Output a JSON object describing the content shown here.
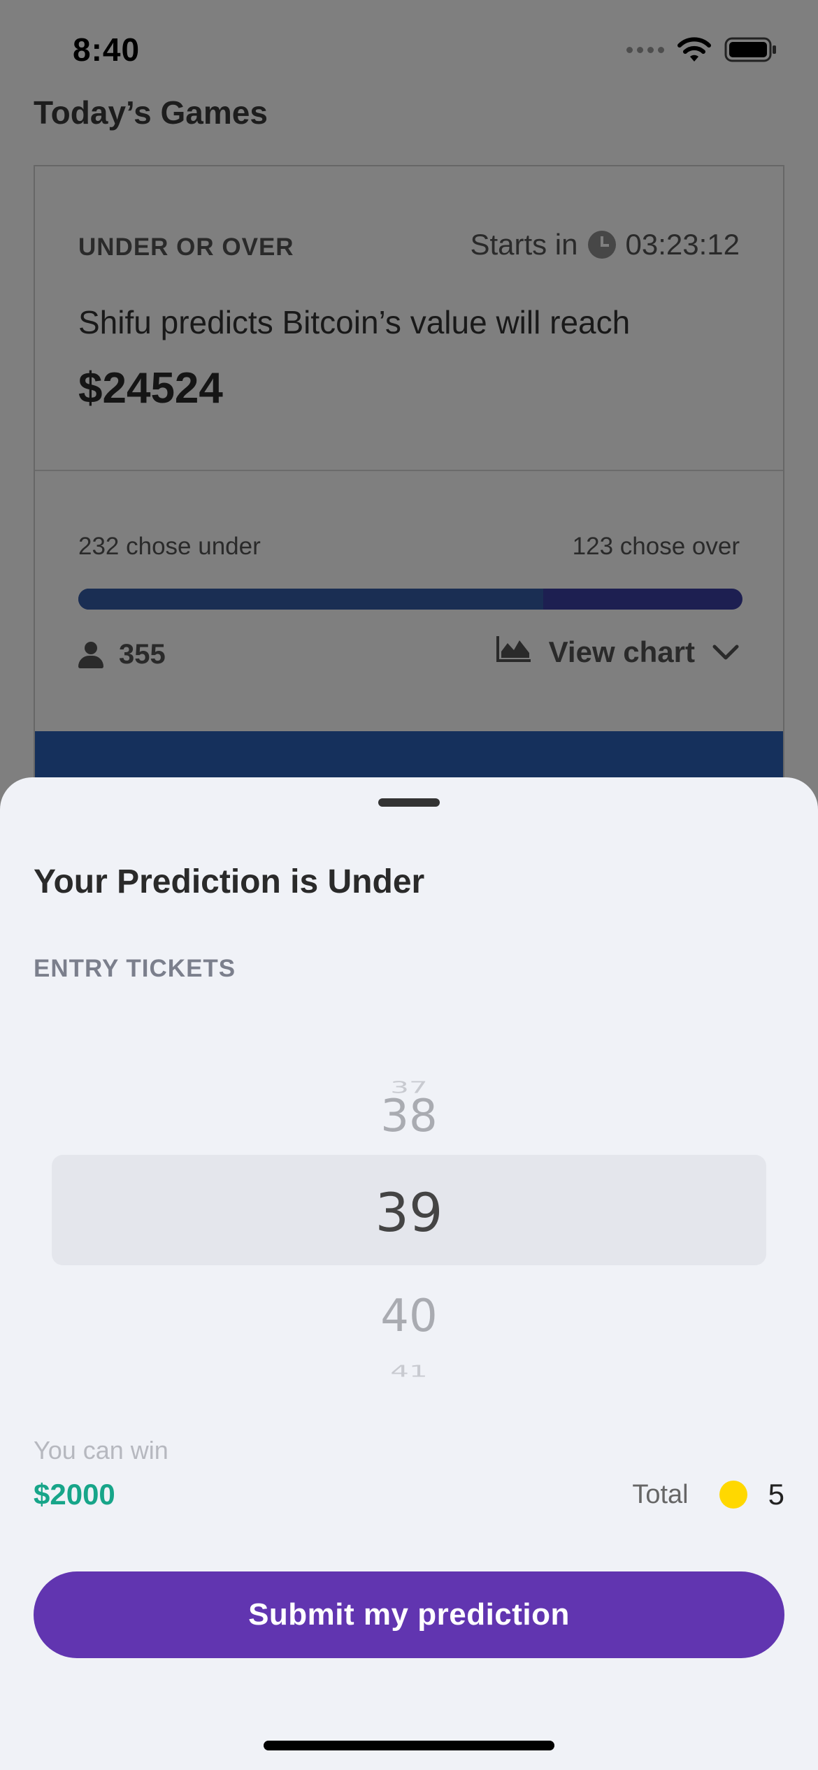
{
  "status_bar": {
    "time": "8:40"
  },
  "screen": {
    "title": "Today’s Games"
  },
  "game": {
    "type": "UNDER OR OVER",
    "starts_label": "Starts in",
    "countdown": "03:23:12",
    "prediction_text": "Shifu predicts Bitcoin’s value will reach",
    "prediction_value": "$24524",
    "under_label": "232 chose under",
    "over_label": "123 chose over",
    "under_fraction": 0.7,
    "participants": "355",
    "view_chart_label": "View chart"
  },
  "sheet": {
    "title": "Your Prediction is Under",
    "entry_label": "ENTRY TICKETS",
    "picker_values": [
      "37",
      "38",
      "39",
      "40",
      "41"
    ],
    "selected_value": "39",
    "win_label": "You can win",
    "win_value": "$2000",
    "total_label": "Total",
    "total_value": "5",
    "submit_label": "Submit my prediction"
  },
  "colors": {
    "accent_purple": "#6135b0",
    "win_green": "#17a589",
    "coin_yellow": "#ffd800",
    "bar_under": "#355da7",
    "bar_over": "#3a3fa2"
  },
  "icons": {
    "clock": "clock-icon",
    "person": "person-icon",
    "chart": "area-chart-icon",
    "chevron": "chevron-down-icon",
    "coin": "coin-icon"
  }
}
